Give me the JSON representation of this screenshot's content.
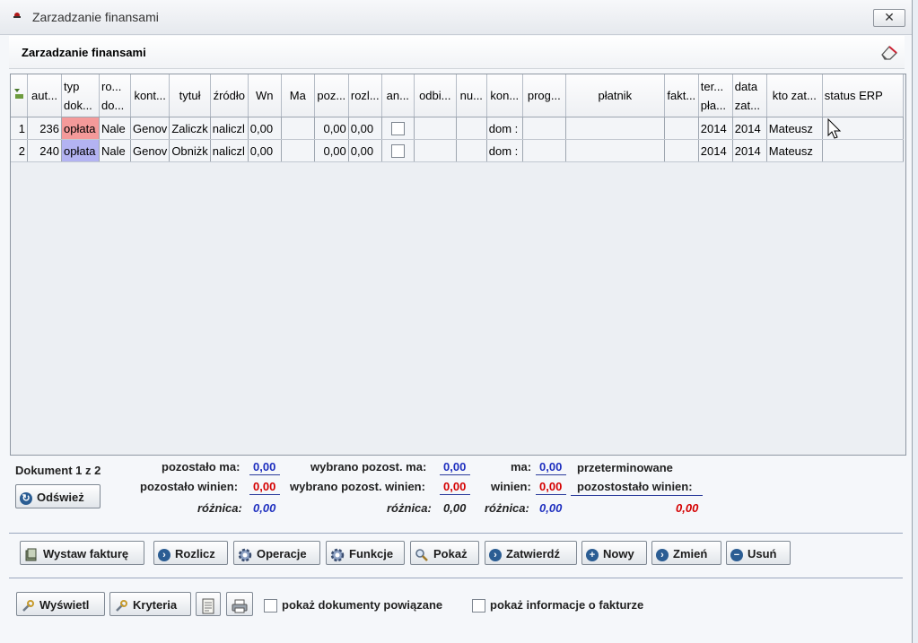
{
  "window": {
    "title": "Zarzadzanie finansami",
    "close_symbol": "✕"
  },
  "header": {
    "title": "Zarzadzanie finansami"
  },
  "table": {
    "columns": [
      "",
      "aut...",
      "typ dok...",
      "ro... do...",
      "kont...",
      "tytuł",
      "źródło",
      "Wn",
      "Ma",
      "poz...",
      "rozl...",
      "an...",
      "odbi...",
      "nu...",
      "kon...",
      "prog...",
      "płatnik",
      "fakt...",
      "ter... pła...",
      "data zat...",
      "kto zat...",
      "status ERP"
    ],
    "rows": [
      {
        "lp": "1",
        "aut": "236",
        "typ": "opłata",
        "typ_color": "#f49a9a",
        "ro": "Nale",
        "kont": "Genov",
        "tytul": "Zaliczk",
        "zrodlo": "naliczl",
        "wn": "0,00",
        "ma": "",
        "poz": "0,00",
        "rozl": "0,00",
        "odbi": "",
        "nu": "",
        "kon": "dom :",
        "prog": "",
        "platnik": "",
        "fakt": "",
        "ter": "2014",
        "data": "2014",
        "kto": "Mateusz",
        "status": ""
      },
      {
        "lp": "2",
        "aut": "240",
        "typ": "opłata",
        "typ_color": "#b3b3f2",
        "ro": "Nale",
        "kont": "Genov",
        "tytul": "Obniżk",
        "zrodlo": "naliczl",
        "wn": "0,00",
        "ma": "",
        "poz": "0,00",
        "rozl": "0,00",
        "odbi": "",
        "nu": "",
        "kon": "dom :",
        "prog": "",
        "platnik": "",
        "fakt": "",
        "ter": "2014",
        "data": "2014",
        "kto": "Mateusz",
        "status": ""
      }
    ]
  },
  "summary": {
    "dokument": "Dokument 1 z 2",
    "refresh_label": "Odśwież",
    "pozostalo_ma_label": "pozostało ma:",
    "pozostalo_ma": "0,00",
    "pozostalo_winien_label": "pozostało winien:",
    "pozostalo_winien": "0,00",
    "roznica_label": "różnica:",
    "roznica1": "0,00",
    "wybrano_ma_label": "wybrano pozost. ma:",
    "wybrano_ma": "0,00",
    "wybrano_winien_label": "wybrano pozost. winien:",
    "wybrano_winien": "0,00",
    "roznica2": "0,00",
    "ma_label": "ma:",
    "ma": "0,00",
    "winien_label": "winien:",
    "winien": "0,00",
    "roznica3": "0,00",
    "przeterminowane_line1": "przeterminowane",
    "przeterminowane_line2": "pozostostało winien:",
    "przeterminowane_value": "0,00"
  },
  "actions": {
    "wystaw": "Wystaw fakturę",
    "rozlicz": "Rozlicz",
    "operacje": "Operacje",
    "funkcje": "Funkcje",
    "pokaz": "Pokaż",
    "zatwierdz": "Zatwierdź",
    "nowy": "Nowy",
    "zmien": "Zmień",
    "usun": "Usuń"
  },
  "footer": {
    "wyswietl": "Wyświetl",
    "kryteria": "Kryteria",
    "chk_powiazane": "pokaż dokumenty powiązane",
    "chk_faktura": "pokaż informacje o fakturze"
  }
}
